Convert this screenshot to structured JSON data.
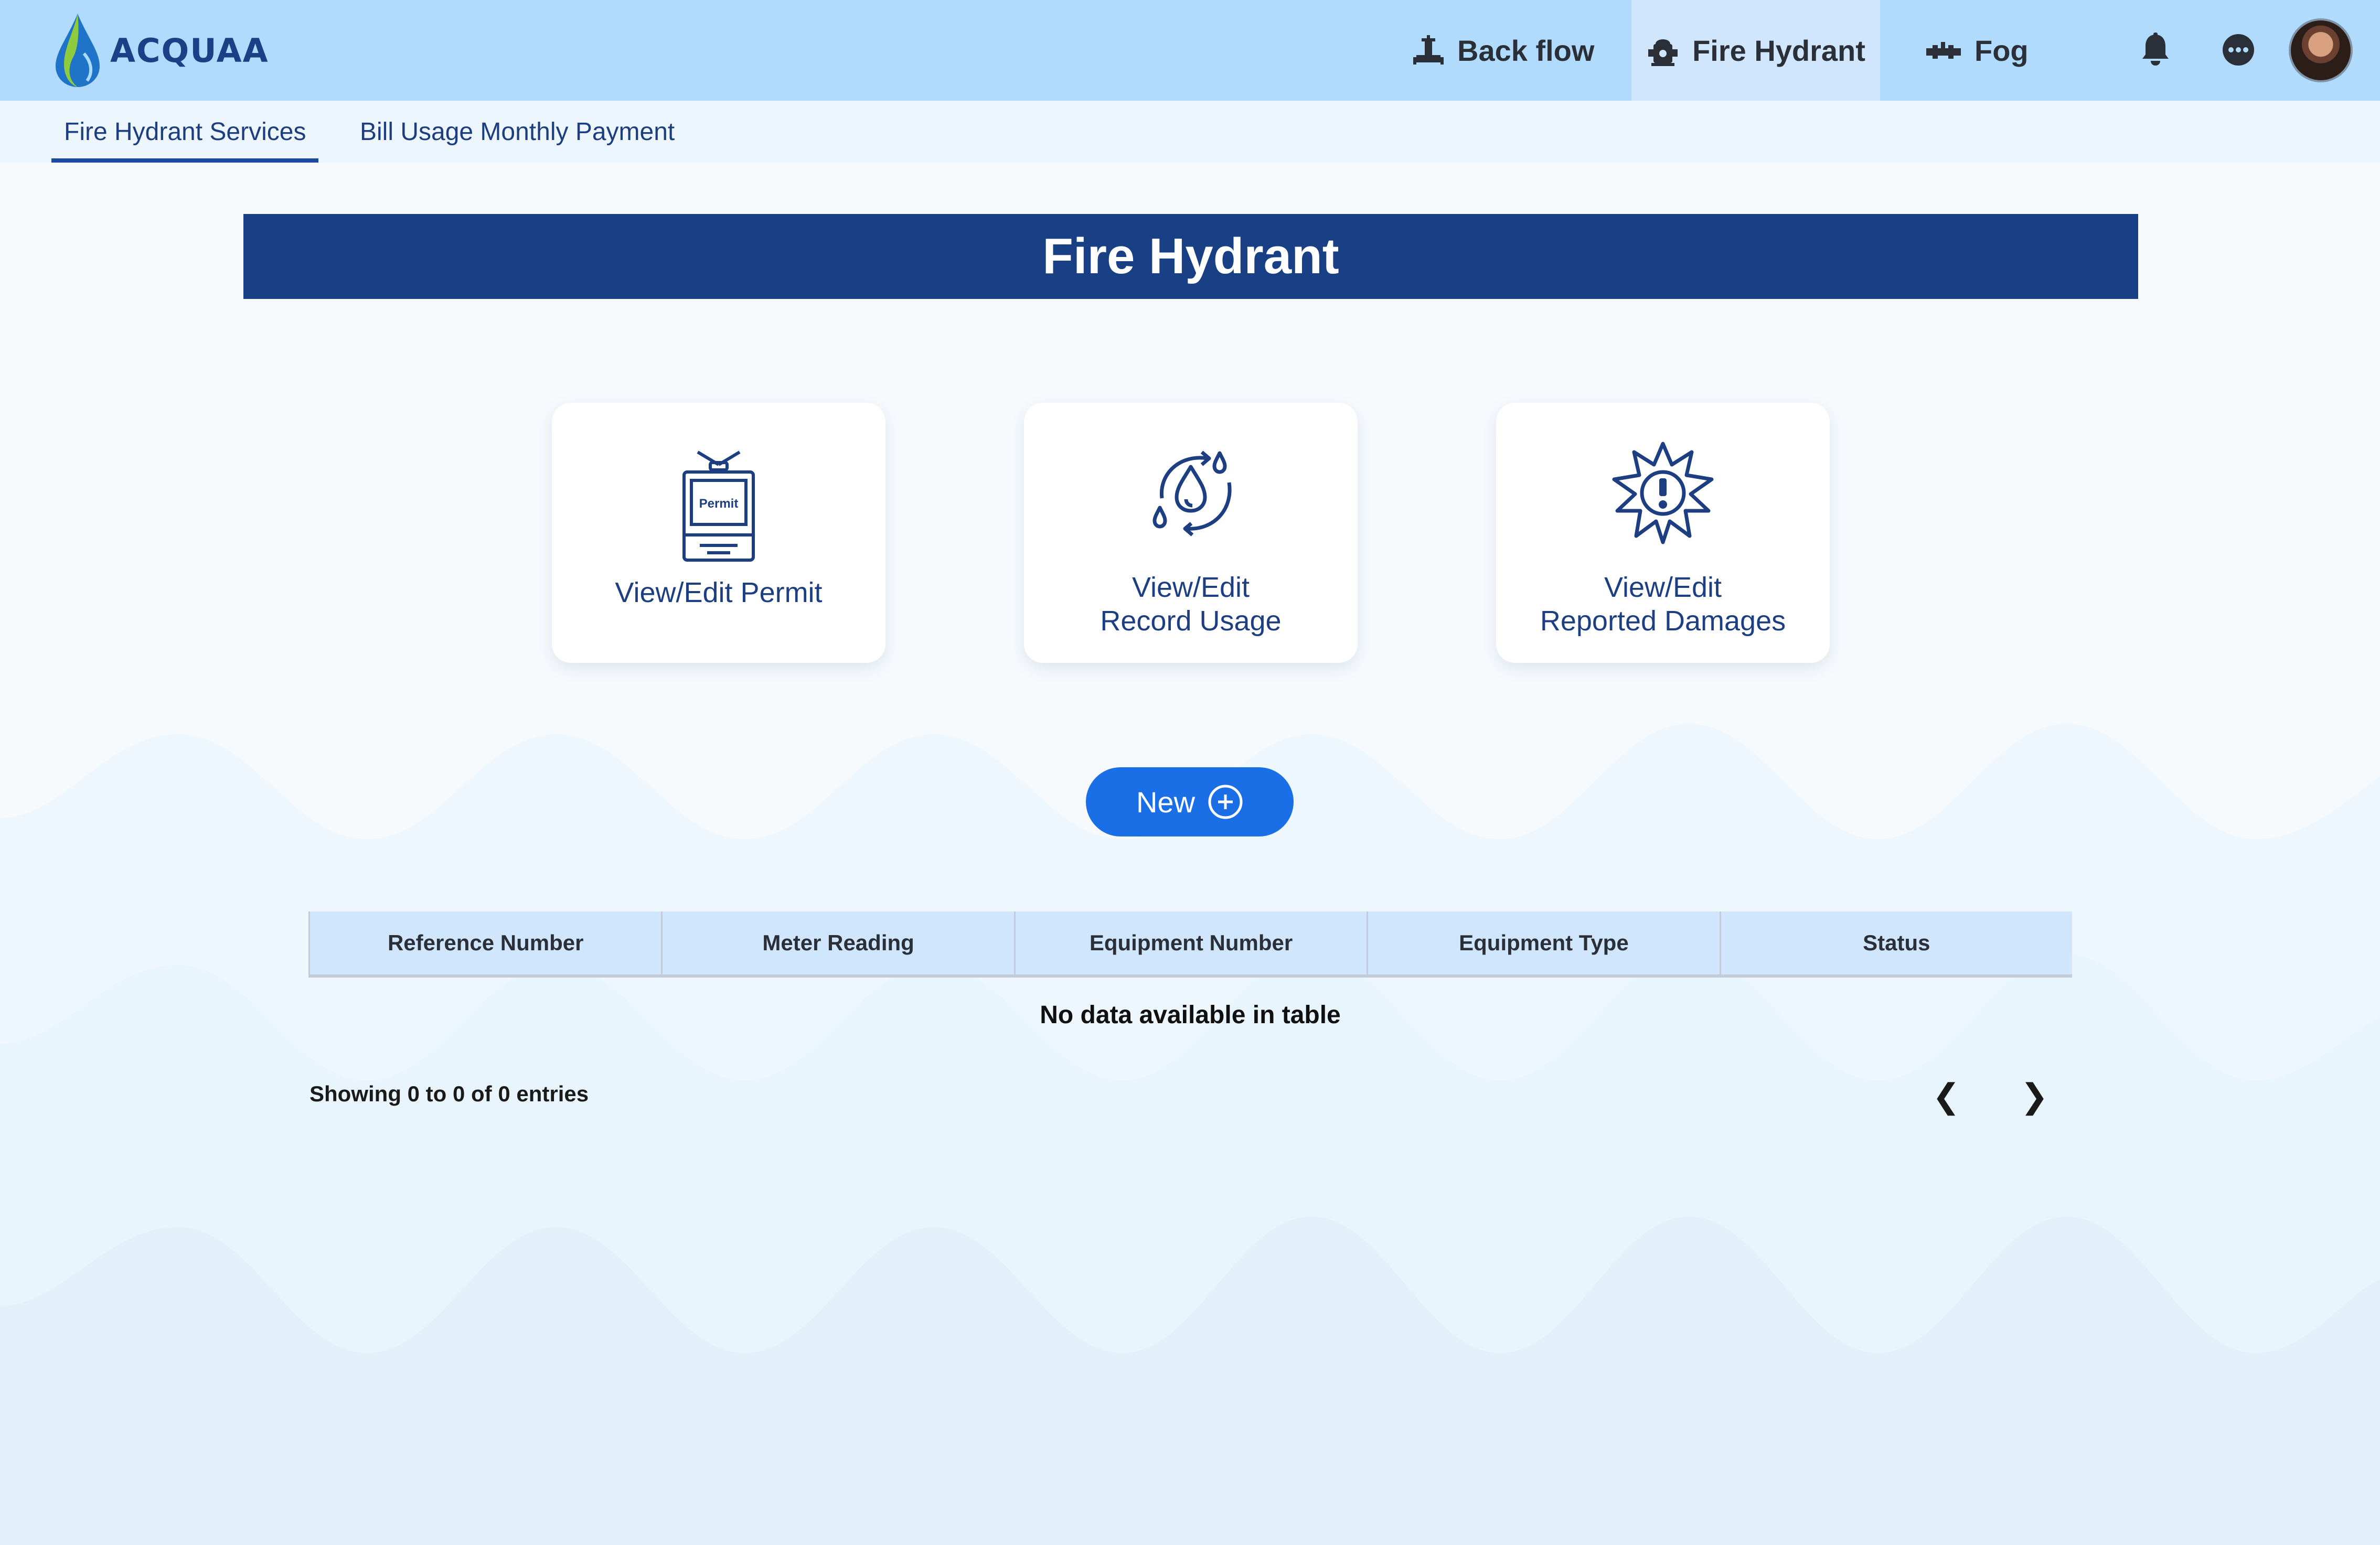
{
  "app": {
    "logo_text": "ACQUAA"
  },
  "nav": [
    {
      "label": "Back flow",
      "icon": "backflow-valve-icon"
    },
    {
      "label": "Fire Hydrant",
      "icon": "fire-hydrant-icon",
      "active": true
    },
    {
      "label": "Fog",
      "icon": "fog-pipe-icon"
    }
  ],
  "header_icons": [
    "bell-icon",
    "more-icon",
    "avatar"
  ],
  "subtabs": [
    {
      "label": "Fire Hydrant Services",
      "active": true
    },
    {
      "label": "Bill Usage Monthly Payment"
    }
  ],
  "page_title": "Fire Hydrant",
  "cards": [
    {
      "line1": "View/Edit Permit",
      "line2": "",
      "icon": "permit-icon",
      "icon_text": "Permit"
    },
    {
      "line1": "View/Edit",
      "line2": "Record Usage",
      "icon": "water-cycle-icon"
    },
    {
      "line1": "View/Edit",
      "line2": "Reported Damages",
      "icon": "damage-alert-icon"
    }
  ],
  "new_button": {
    "label": "New"
  },
  "table": {
    "columns": [
      "Reference Number",
      "Meter Reading",
      "Equipment Number",
      "Equipment Type",
      "Status"
    ],
    "empty_text": "No data available in table",
    "info": "Showing 0 to 0 of 0 entries",
    "prev": "❮",
    "next": "❯"
  },
  "colors": {
    "topbar": "#b0dbfc",
    "active_tab": "#cfe6fd",
    "banner": "#193f84",
    "primary": "#1a6fe6",
    "text_dark_blue": "#1d3f82"
  }
}
